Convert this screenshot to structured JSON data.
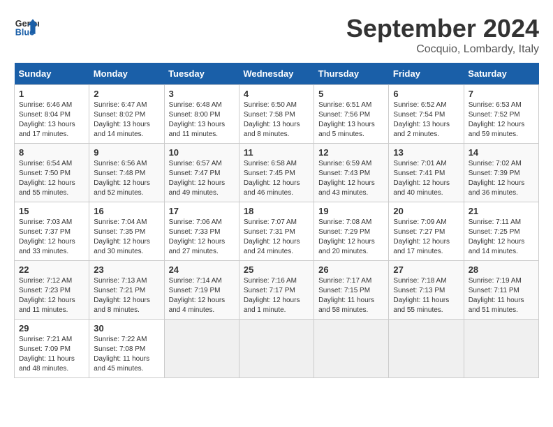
{
  "header": {
    "logo_line1": "General",
    "logo_line2": "Blue",
    "month": "September 2024",
    "location": "Cocquio, Lombardy, Italy"
  },
  "days_of_week": [
    "Sunday",
    "Monday",
    "Tuesday",
    "Wednesday",
    "Thursday",
    "Friday",
    "Saturday"
  ],
  "weeks": [
    [
      {
        "num": "1",
        "info": "Sunrise: 6:46 AM\nSunset: 8:04 PM\nDaylight: 13 hours and 17 minutes."
      },
      {
        "num": "2",
        "info": "Sunrise: 6:47 AM\nSunset: 8:02 PM\nDaylight: 13 hours and 14 minutes."
      },
      {
        "num": "3",
        "info": "Sunrise: 6:48 AM\nSunset: 8:00 PM\nDaylight: 13 hours and 11 minutes."
      },
      {
        "num": "4",
        "info": "Sunrise: 6:50 AM\nSunset: 7:58 PM\nDaylight: 13 hours and 8 minutes."
      },
      {
        "num": "5",
        "info": "Sunrise: 6:51 AM\nSunset: 7:56 PM\nDaylight: 13 hours and 5 minutes."
      },
      {
        "num": "6",
        "info": "Sunrise: 6:52 AM\nSunset: 7:54 PM\nDaylight: 13 hours and 2 minutes."
      },
      {
        "num": "7",
        "info": "Sunrise: 6:53 AM\nSunset: 7:52 PM\nDaylight: 12 hours and 59 minutes."
      }
    ],
    [
      {
        "num": "8",
        "info": "Sunrise: 6:54 AM\nSunset: 7:50 PM\nDaylight: 12 hours and 55 minutes."
      },
      {
        "num": "9",
        "info": "Sunrise: 6:56 AM\nSunset: 7:48 PM\nDaylight: 12 hours and 52 minutes."
      },
      {
        "num": "10",
        "info": "Sunrise: 6:57 AM\nSunset: 7:47 PM\nDaylight: 12 hours and 49 minutes."
      },
      {
        "num": "11",
        "info": "Sunrise: 6:58 AM\nSunset: 7:45 PM\nDaylight: 12 hours and 46 minutes."
      },
      {
        "num": "12",
        "info": "Sunrise: 6:59 AM\nSunset: 7:43 PM\nDaylight: 12 hours and 43 minutes."
      },
      {
        "num": "13",
        "info": "Sunrise: 7:01 AM\nSunset: 7:41 PM\nDaylight: 12 hours and 40 minutes."
      },
      {
        "num": "14",
        "info": "Sunrise: 7:02 AM\nSunset: 7:39 PM\nDaylight: 12 hours and 36 minutes."
      }
    ],
    [
      {
        "num": "15",
        "info": "Sunrise: 7:03 AM\nSunset: 7:37 PM\nDaylight: 12 hours and 33 minutes."
      },
      {
        "num": "16",
        "info": "Sunrise: 7:04 AM\nSunset: 7:35 PM\nDaylight: 12 hours and 30 minutes."
      },
      {
        "num": "17",
        "info": "Sunrise: 7:06 AM\nSunset: 7:33 PM\nDaylight: 12 hours and 27 minutes."
      },
      {
        "num": "18",
        "info": "Sunrise: 7:07 AM\nSunset: 7:31 PM\nDaylight: 12 hours and 24 minutes."
      },
      {
        "num": "19",
        "info": "Sunrise: 7:08 AM\nSunset: 7:29 PM\nDaylight: 12 hours and 20 minutes."
      },
      {
        "num": "20",
        "info": "Sunrise: 7:09 AM\nSunset: 7:27 PM\nDaylight: 12 hours and 17 minutes."
      },
      {
        "num": "21",
        "info": "Sunrise: 7:11 AM\nSunset: 7:25 PM\nDaylight: 12 hours and 14 minutes."
      }
    ],
    [
      {
        "num": "22",
        "info": "Sunrise: 7:12 AM\nSunset: 7:23 PM\nDaylight: 12 hours and 11 minutes."
      },
      {
        "num": "23",
        "info": "Sunrise: 7:13 AM\nSunset: 7:21 PM\nDaylight: 12 hours and 8 minutes."
      },
      {
        "num": "24",
        "info": "Sunrise: 7:14 AM\nSunset: 7:19 PM\nDaylight: 12 hours and 4 minutes."
      },
      {
        "num": "25",
        "info": "Sunrise: 7:16 AM\nSunset: 7:17 PM\nDaylight: 12 hours and 1 minute."
      },
      {
        "num": "26",
        "info": "Sunrise: 7:17 AM\nSunset: 7:15 PM\nDaylight: 11 hours and 58 minutes."
      },
      {
        "num": "27",
        "info": "Sunrise: 7:18 AM\nSunset: 7:13 PM\nDaylight: 11 hours and 55 minutes."
      },
      {
        "num": "28",
        "info": "Sunrise: 7:19 AM\nSunset: 7:11 PM\nDaylight: 11 hours and 51 minutes."
      }
    ],
    [
      {
        "num": "29",
        "info": "Sunrise: 7:21 AM\nSunset: 7:09 PM\nDaylight: 11 hours and 48 minutes."
      },
      {
        "num": "30",
        "info": "Sunrise: 7:22 AM\nSunset: 7:08 PM\nDaylight: 11 hours and 45 minutes."
      },
      null,
      null,
      null,
      null,
      null
    ]
  ]
}
